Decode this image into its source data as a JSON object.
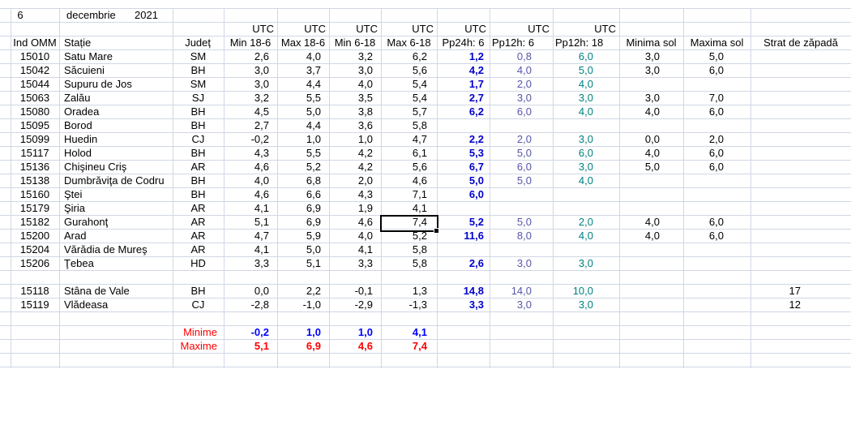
{
  "header": {
    "day": "6",
    "month": "decembrie",
    "year": "2021"
  },
  "utc_label": "UTC",
  "columns": [
    "Ind OMM",
    "Stație",
    "Județ",
    "Min 18-6",
    "Max 18-6",
    "Min 6-18",
    "Max 6-18",
    "Pp24h: 6",
    "Pp12h: 6",
    "Pp12h: 18",
    "Minima sol",
    "Maxima sol",
    "Strat de zăpadă"
  ],
  "rows": [
    {
      "id": "15010",
      "name": "Satu Mare",
      "county": "SM",
      "min186": "2,6",
      "max186": "4,0",
      "min618": "3,2",
      "max618": "6,2",
      "pp24": "1,2",
      "pp12a": "0,8",
      "pp12b": "6,0",
      "minsol": "3,0",
      "maxsol": "5,0",
      "snow": ""
    },
    {
      "id": "15042",
      "name": "Săcuieni",
      "county": "BH",
      "min186": "3,0",
      "max186": "3,7",
      "min618": "3,0",
      "max618": "5,6",
      "pp24": "4,2",
      "pp12a": "4,0",
      "pp12b": "5,0",
      "minsol": "3,0",
      "maxsol": "6,0",
      "snow": ""
    },
    {
      "id": "15044",
      "name": "Supuru de Jos",
      "county": "SM",
      "min186": "3,0",
      "max186": "4,4",
      "min618": "4,0",
      "max618": "5,4",
      "pp24": "1,7",
      "pp12a": "2,0",
      "pp12b": "4,0",
      "minsol": "",
      "maxsol": "",
      "snow": ""
    },
    {
      "id": "15063",
      "name": "Zalău",
      "county": "SJ",
      "min186": "3,2",
      "max186": "5,5",
      "min618": "3,5",
      "max618": "5,4",
      "pp24": "2,7",
      "pp12a": "3,0",
      "pp12b": "3,0",
      "minsol": "3,0",
      "maxsol": "7,0",
      "snow": ""
    },
    {
      "id": "15080",
      "name": "Oradea",
      "county": "BH",
      "min186": "4,5",
      "max186": "5,0",
      "min618": "3,8",
      "max618": "5,7",
      "pp24": "6,2",
      "pp12a": "6,0",
      "pp12b": "4,0",
      "minsol": "4,0",
      "maxsol": "6,0",
      "snow": ""
    },
    {
      "id": "15095",
      "name": "Borod",
      "county": "BH",
      "min186": "2,7",
      "max186": "4,4",
      "min618": "3,6",
      "max618": "5,8",
      "pp24": "",
      "pp12a": "",
      "pp12b": "",
      "minsol": "",
      "maxsol": "",
      "snow": ""
    },
    {
      "id": "15099",
      "name": "Huedin",
      "county": "CJ",
      "min186": "-0,2",
      "max186": "1,0",
      "min618": "1,0",
      "max618": "4,7",
      "pp24": "2,2",
      "pp12a": "2,0",
      "pp12b": "3,0",
      "minsol": "0,0",
      "maxsol": "2,0",
      "snow": ""
    },
    {
      "id": "15117",
      "name": "Holod",
      "county": "BH",
      "min186": "4,3",
      "max186": "5,5",
      "min618": "4,2",
      "max618": "6,1",
      "pp24": "5,3",
      "pp12a": "5,0",
      "pp12b": "6,0",
      "minsol": "4,0",
      "maxsol": "6,0",
      "snow": ""
    },
    {
      "id": "15136",
      "name": "Chişineu      Criş",
      "county": "AR",
      "min186": "4,6",
      "max186": "5,2",
      "min618": "4,2",
      "max618": "5,6",
      "pp24": "6,7",
      "pp12a": "6,0",
      "pp12b": "3,0",
      "minsol": "5,0",
      "maxsol": "6,0",
      "snow": ""
    },
    {
      "id": "15138",
      "name": "Dumbrăviţa   de Codru",
      "county": "BH",
      "min186": "4,0",
      "max186": "6,8",
      "min618": "2,0",
      "max618": "4,6",
      "pp24": "5,0",
      "pp12a": "5,0",
      "pp12b": "4,0",
      "minsol": "",
      "maxsol": "",
      "snow": ""
    },
    {
      "id": "15160",
      "name": "Ştei",
      "county": "BH",
      "min186": "4,6",
      "max186": "6,6",
      "min618": "4,3",
      "max618": "7,1",
      "pp24": "6,0",
      "pp12a": "",
      "pp12b": "",
      "minsol": "",
      "maxsol": "",
      "snow": ""
    },
    {
      "id": "15179",
      "name": "Şiria",
      "county": "AR",
      "min186": "4,1",
      "max186": "6,9",
      "min618": "1,9",
      "max618": "4,1",
      "pp24": "",
      "pp12a": "",
      "pp12b": "",
      "minsol": "",
      "maxsol": "",
      "snow": ""
    },
    {
      "id": "15182",
      "name": "Gurahonţ",
      "county": "AR",
      "min186": "5,1",
      "max186": "6,9",
      "min618": "4,6",
      "max618": "7,4",
      "pp24": "5,2",
      "pp12a": "5,0",
      "pp12b": "2,0",
      "minsol": "4,0",
      "maxsol": "6,0",
      "snow": ""
    },
    {
      "id": "15200",
      "name": "Arad",
      "county": "AR",
      "min186": "4,7",
      "max186": "5,9",
      "min618": "4,0",
      "max618": "5,2",
      "pp24": "11,6",
      "pp12a": "8,0",
      "pp12b": "4,0",
      "minsol": "4,0",
      "maxsol": "6,0",
      "snow": ""
    },
    {
      "id": "15204",
      "name": "Vărădia de Mureş",
      "county": "AR",
      "min186": "4,1",
      "max186": "5,0",
      "min618": "4,1",
      "max618": "5,8",
      "pp24": "",
      "pp12a": "",
      "pp12b": "",
      "minsol": "",
      "maxsol": "",
      "snow": ""
    },
    {
      "id": "15206",
      "name": "Ţebea",
      "county": "HD",
      "min186": "3,3",
      "max186": "5,1",
      "min618": "3,3",
      "max618": "5,8",
      "pp24": "2,6",
      "pp12a": "3,0",
      "pp12b": "3,0",
      "minsol": "",
      "maxsol": "",
      "snow": ""
    },
    {
      "id": "",
      "name": "",
      "county": "",
      "min186": "",
      "max186": "",
      "min618": "",
      "max618": "",
      "pp24": "",
      "pp12a": "",
      "pp12b": "",
      "minsol": "",
      "maxsol": "",
      "snow": ""
    },
    {
      "id": "15118",
      "name": "Stâna de Vale",
      "county": "BH",
      "min186": "0,0",
      "max186": "2,2",
      "min618": "-0,1",
      "max618": "1,3",
      "pp24": "14,8",
      "pp12a": "14,0",
      "pp12b": "10,0",
      "minsol": "",
      "maxsol": "",
      "snow": "17"
    },
    {
      "id": "15119",
      "name": "Vlădeasa",
      "county": "CJ",
      "min186": "-2,8",
      "max186": "-1,0",
      "min618": "-2,9",
      "max618": "-1,3",
      "pp24": "3,3",
      "pp12a": "3,0",
      "pp12b": "3,0",
      "minsol": "",
      "maxsol": "",
      "snow": "12"
    }
  ],
  "summary": {
    "min_label": "Minime",
    "max_label": "Maxime",
    "minime": [
      "-0,2",
      "1,0",
      "1,0",
      "4,1"
    ],
    "maxime": [
      "5,1",
      "6,9",
      "4,6",
      "7,4"
    ]
  },
  "colors": {
    "grid": "#d0d7e5",
    "pp24": "#0000cc",
    "pp12a": "#5555aa",
    "pp12b": "#008080",
    "minime": "#0000ff",
    "maxime": "#ff0000"
  }
}
